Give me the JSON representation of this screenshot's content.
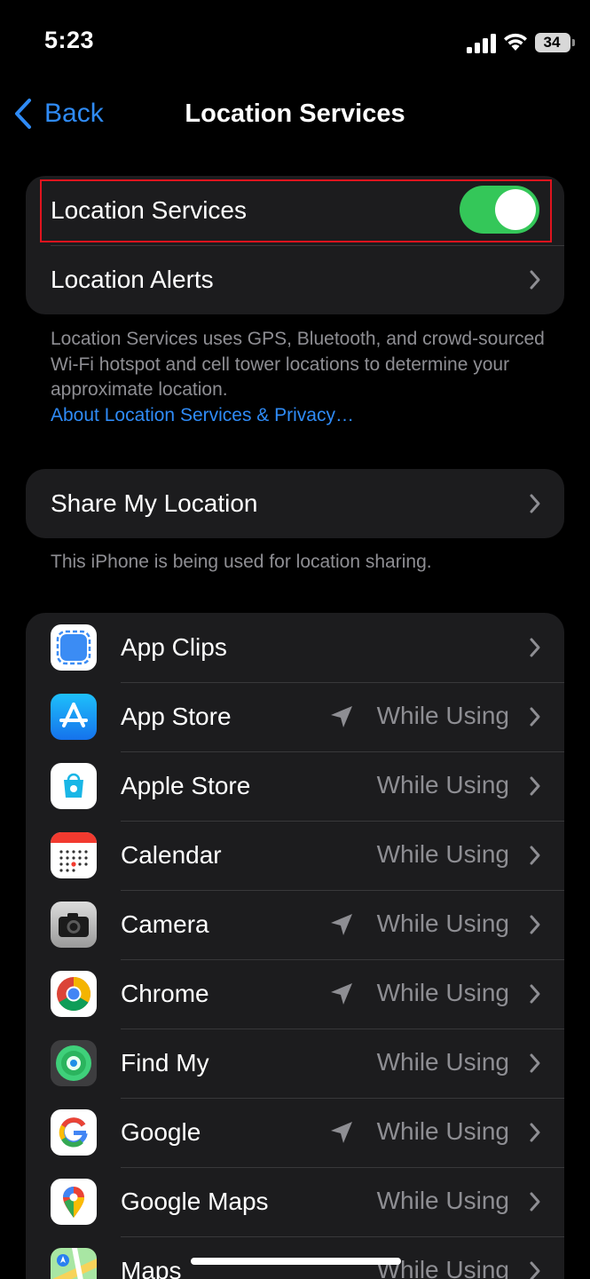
{
  "status_bar": {
    "time": "5:23",
    "battery": "34"
  },
  "nav": {
    "back_label": "Back",
    "title": "Location Services"
  },
  "main_group": {
    "toggle_label": "Location Services",
    "toggle_on": true,
    "alerts_label": "Location Alerts"
  },
  "main_footnote": {
    "text": "Location Services uses GPS, Bluetooth, and crowd-sourced Wi-Fi hotspot and cell tower locations to determine your approximate location.",
    "link": "About Location Services & Privacy…"
  },
  "share": {
    "label": "Share My Location",
    "footnote": "This iPhone is being used for location sharing."
  },
  "apps": [
    {
      "name": "App Clips",
      "icon": "app-clips-icon",
      "permission": "",
      "recent_arrow": false
    },
    {
      "name": "App Store",
      "icon": "app-store-icon",
      "permission": "While Using",
      "recent_arrow": true
    },
    {
      "name": "Apple Store",
      "icon": "apple-store-icon",
      "permission": "While Using",
      "recent_arrow": false
    },
    {
      "name": "Calendar",
      "icon": "calendar-icon",
      "permission": "While Using",
      "recent_arrow": false
    },
    {
      "name": "Camera",
      "icon": "camera-icon",
      "permission": "While Using",
      "recent_arrow": true
    },
    {
      "name": "Chrome",
      "icon": "chrome-icon",
      "permission": "While Using",
      "recent_arrow": true
    },
    {
      "name": "Find My",
      "icon": "find-my-icon",
      "permission": "While Using",
      "recent_arrow": false
    },
    {
      "name": "Google",
      "icon": "google-icon",
      "permission": "While Using",
      "recent_arrow": true
    },
    {
      "name": "Google Maps",
      "icon": "google-maps-icon",
      "permission": "While Using",
      "recent_arrow": false
    },
    {
      "name": "Maps",
      "icon": "maps-icon",
      "permission": "While Using",
      "recent_arrow": false
    }
  ],
  "colors": {
    "accent": "#2f8bf6",
    "toggle_on": "#34c759",
    "highlight_box": "#e0141e",
    "background": "#000000",
    "cell": "#1c1c1e"
  }
}
